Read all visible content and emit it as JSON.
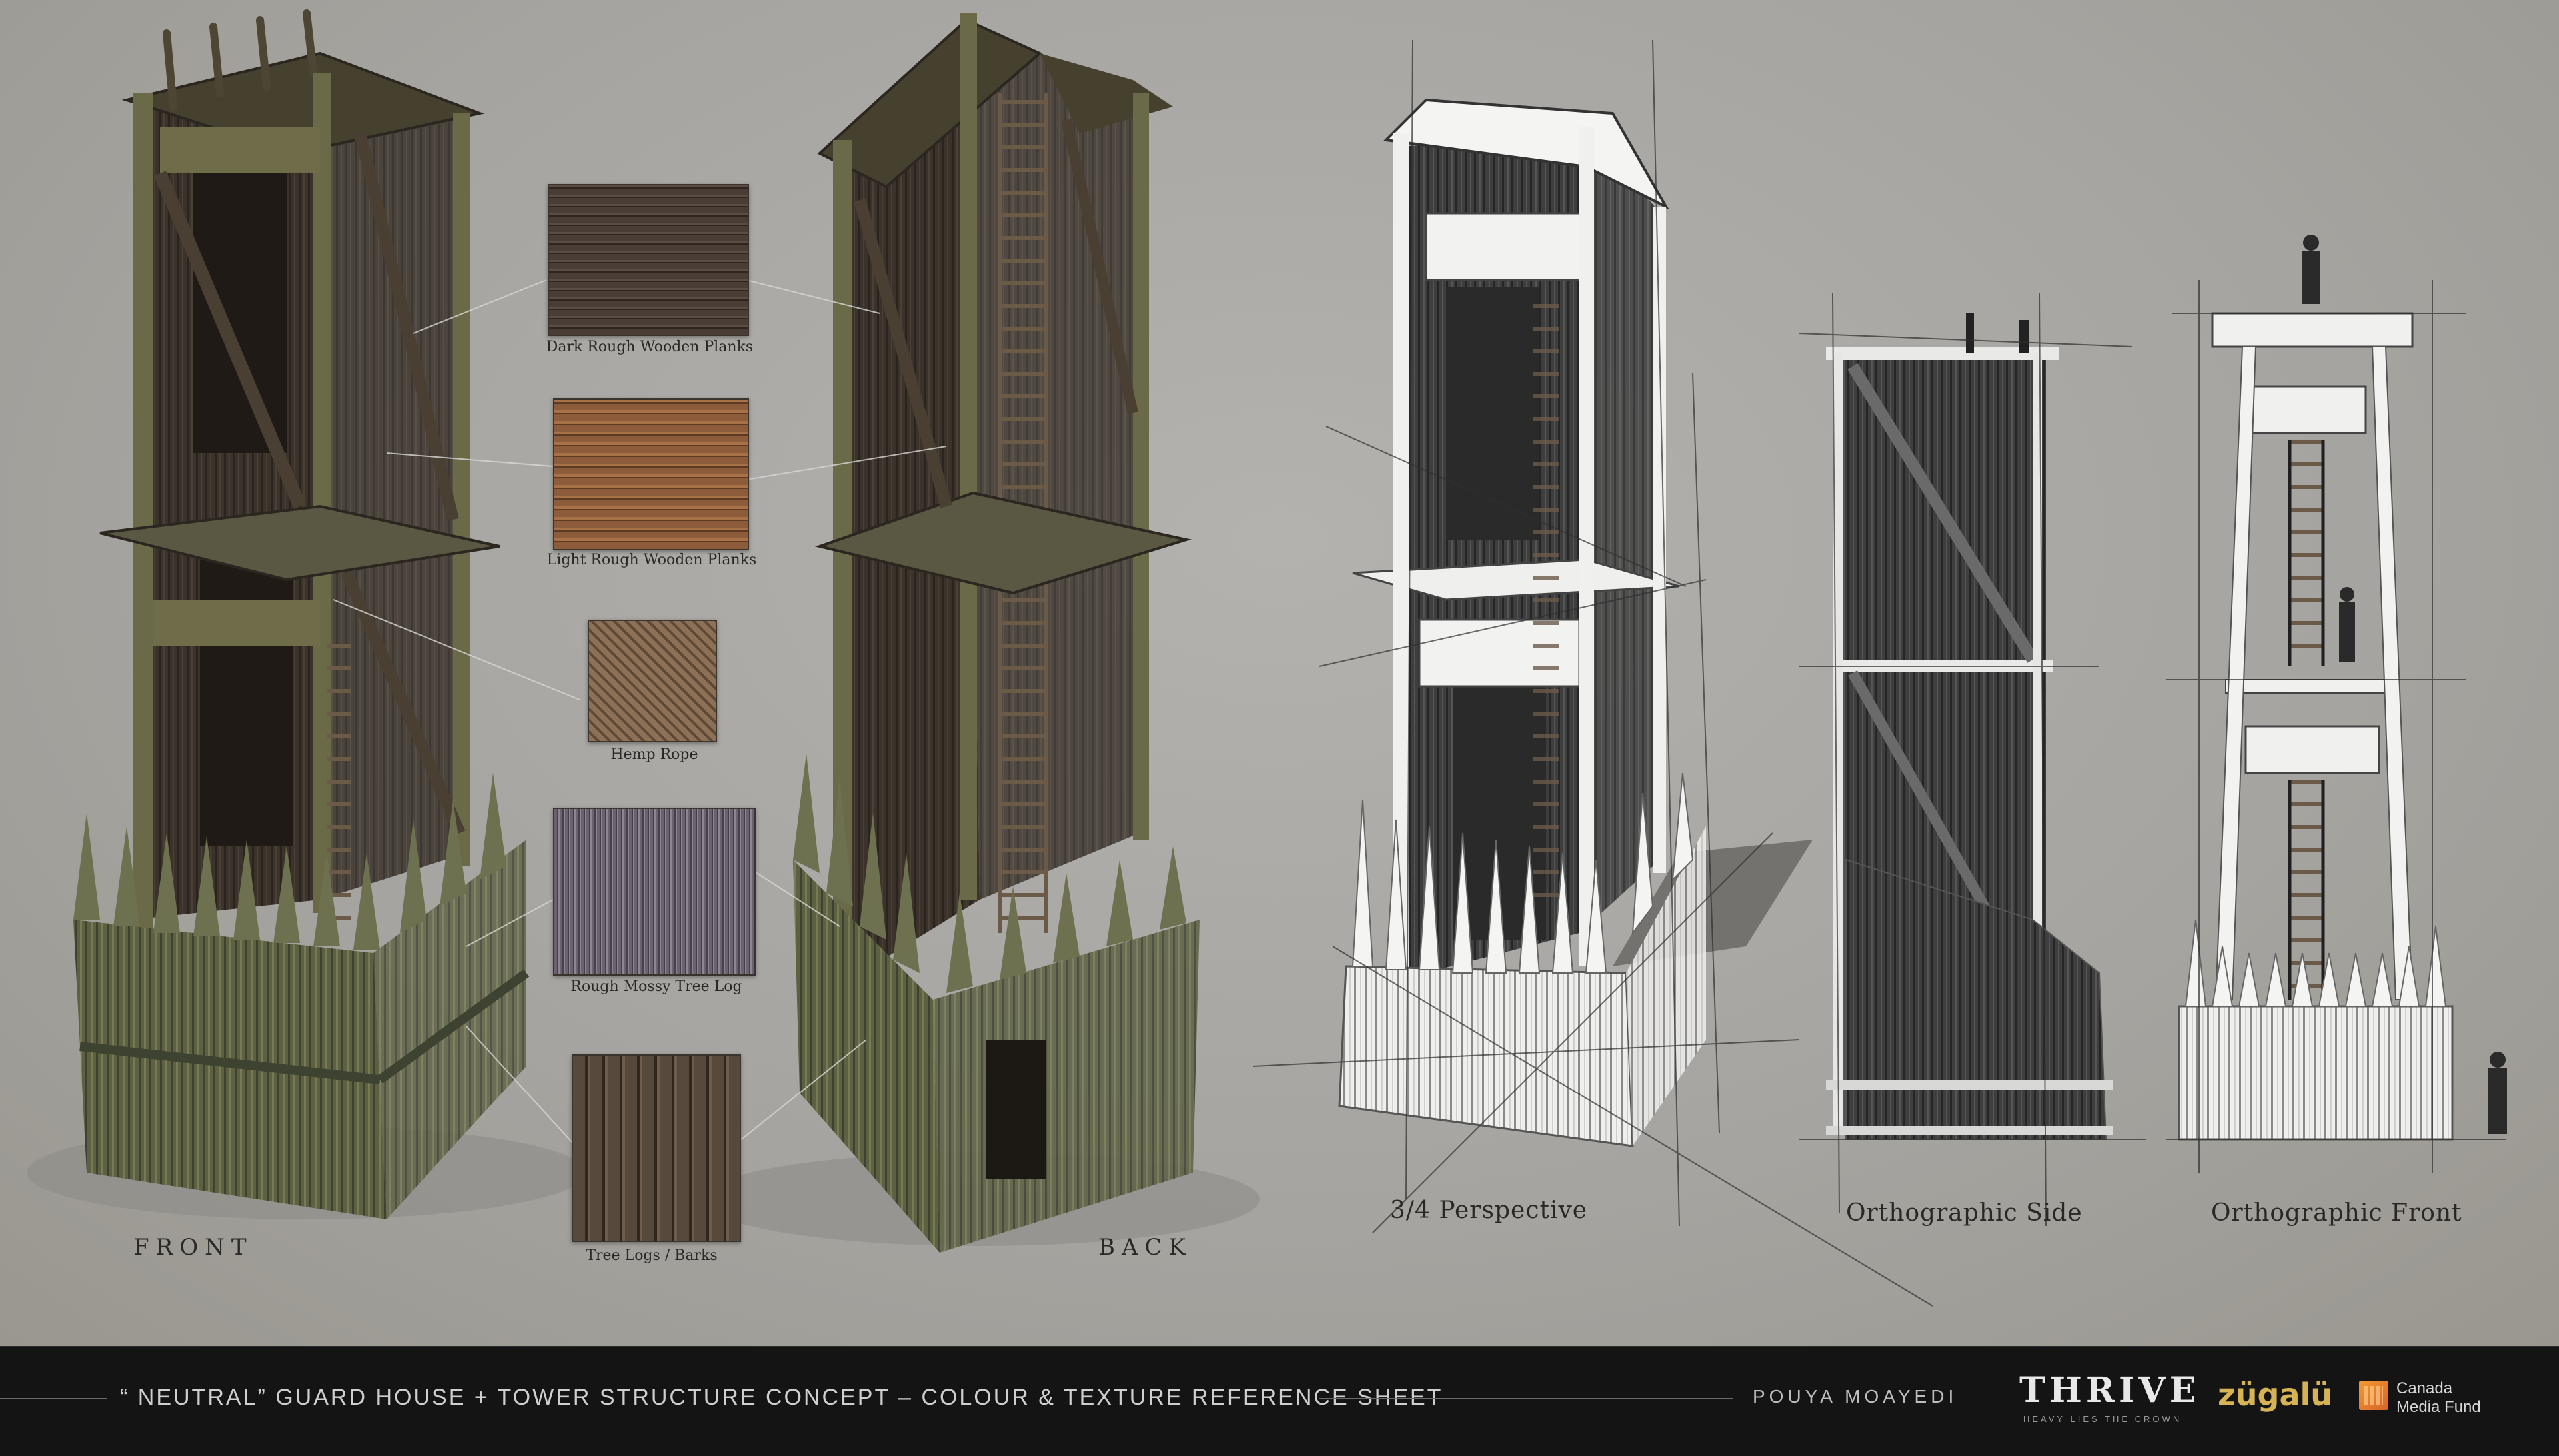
{
  "labels": {
    "front": "FRONT",
    "back": "BACK",
    "perspective": "3/4 Perspective",
    "ortho_side": "Orthographic Side",
    "ortho_front": "Orthographic Front"
  },
  "textures": [
    {
      "name": "Dark Rough Wooden Planks",
      "color": "#4a3d36"
    },
    {
      "name": "Light Rough Wooden Planks",
      "color": "#8a5a3a"
    },
    {
      "name": "Hemp Rope",
      "color": "#8e7358"
    },
    {
      "name": "Rough Mossy Tree Log",
      "color": "#6a6068"
    },
    {
      "name": "Tree Logs / Barks",
      "color": "#54483c"
    }
  ],
  "footer": {
    "title": "“ NEUTRAL” GUARD HOUSE + TOWER STRUCTURE CONCEPT – COLOUR & TEXTURE REFERENCE SHEET",
    "author": "POUYA MOAYEDI",
    "brand": "THRIVE",
    "brand_tagline": "HEAVY LIES THE CROWN",
    "partner": "zügalü",
    "fund": "Canada Media Fund"
  },
  "colors": {
    "background": "#a9a7a3",
    "wood_dark": "#3c342b",
    "moss": "#5f6345",
    "sketch_white": "#f2f2f0",
    "footer": "#141414"
  }
}
